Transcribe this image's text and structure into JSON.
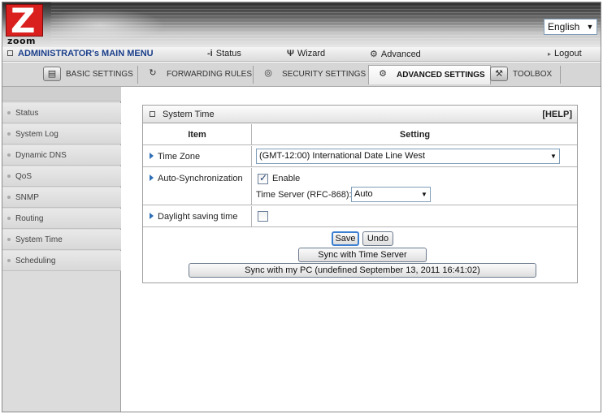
{
  "brand": {
    "logo_letter": "Z",
    "logo_word": "zoom"
  },
  "language": {
    "selected": "English"
  },
  "menubar": {
    "title": "ADMINISTRATOR's MAIN MENU",
    "items": [
      {
        "label": "Status",
        "icon": "info-icon"
      },
      {
        "label": "Wizard",
        "icon": "wizard-icon"
      },
      {
        "label": "Advanced",
        "icon": "advanced-icon"
      }
    ],
    "logout": "Logout"
  },
  "tabs": [
    {
      "label": "BASIC SETTINGS",
      "icon": "basic-settings-icon"
    },
    {
      "label": "FORWARDING RULES",
      "icon": "forwarding-rules-icon"
    },
    {
      "label": "SECURITY SETTINGS",
      "icon": "security-settings-icon"
    },
    {
      "label": "ADVANCED SETTINGS",
      "icon": "advanced-settings-icon",
      "active": true
    },
    {
      "label": "TOOLBOX",
      "icon": "toolbox-icon"
    }
  ],
  "sidebar": {
    "items": [
      {
        "label": "Status"
      },
      {
        "label": "System Log"
      },
      {
        "label": "Dynamic DNS"
      },
      {
        "label": "QoS"
      },
      {
        "label": "SNMP"
      },
      {
        "label": "Routing"
      },
      {
        "label": "System Time"
      },
      {
        "label": "Scheduling"
      }
    ]
  },
  "panel": {
    "title": "System Time",
    "help": "[HELP]",
    "header_item": "Item",
    "header_setting": "Setting",
    "time_zone": {
      "label": "Time Zone",
      "value": "(GMT-12:00) International Date Line West"
    },
    "auto_sync": {
      "label": "Auto-Synchronization",
      "enable_label": "Enable",
      "enabled": true,
      "server_label": "Time Server (RFC-868):",
      "server_value": "Auto"
    },
    "dst": {
      "label": "Daylight saving time",
      "checked": false
    },
    "buttons": {
      "save": "Save",
      "undo": "Undo",
      "sync_server": "Sync with Time Server",
      "sync_pc": "Sync with my PC (undefined September 13, 2011 16:41:02)"
    }
  }
}
